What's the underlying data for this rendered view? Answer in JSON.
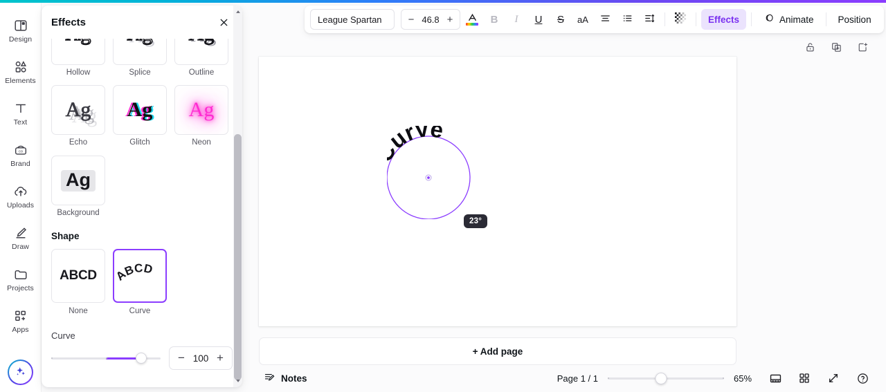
{
  "sidebar": {
    "items": [
      {
        "label": "Design",
        "icon": "design-icon"
      },
      {
        "label": "Elements",
        "icon": "elements-icon"
      },
      {
        "label": "Text",
        "icon": "text-icon"
      },
      {
        "label": "Brand",
        "icon": "brand-icon"
      },
      {
        "label": "Uploads",
        "icon": "uploads-icon"
      },
      {
        "label": "Draw",
        "icon": "draw-icon"
      },
      {
        "label": "Projects",
        "icon": "projects-icon"
      },
      {
        "label": "Apps",
        "icon": "apps-icon"
      }
    ],
    "magic_button_icon": "magic-sparkle-icon"
  },
  "panel": {
    "title": "Effects",
    "close_icon": "close-icon",
    "style_effects": [
      {
        "label": "Hollow",
        "sample": "Ag",
        "clipped": true
      },
      {
        "label": "Splice",
        "sample": "Ag",
        "clipped": true
      },
      {
        "label": "Outline",
        "sample": "Ag",
        "clipped": true
      },
      {
        "label": "Echo",
        "sample": "Ag",
        "clipped": false
      },
      {
        "label": "Glitch",
        "sample": "Ag",
        "clipped": false
      },
      {
        "label": "Neon",
        "sample": "Ag",
        "clipped": false
      },
      {
        "label": "Background",
        "sample": "Ag",
        "clipped": false
      }
    ],
    "shape": {
      "section_title": "Shape",
      "options": [
        {
          "label": "None",
          "sample": "ABCD",
          "selected": false
        },
        {
          "label": "Curve",
          "sample": "ABCD",
          "selected": true
        }
      ],
      "slider_label": "Curve",
      "slider_value": "100",
      "minus_label": "−",
      "plus_label": "+"
    }
  },
  "toolbar": {
    "font_name": "League Spartan",
    "font_size": "46.8",
    "size_minus": "−",
    "size_plus": "+",
    "text_color_icon": "text-color-icon",
    "bold_label": "B",
    "italic_label": "I",
    "underline_label": "U",
    "strikethrough_label": "S",
    "case_label": "aA",
    "align_icon": "align-center-icon",
    "list_icon": "bullet-list-icon",
    "spacing_icon": "line-spacing-icon",
    "transparency_icon": "transparency-icon",
    "effects_label": "Effects",
    "animate_label": "Animate",
    "animate_icon": "animate-icon",
    "position_label": "Position"
  },
  "canvas": {
    "lock_icon": "unlock-icon",
    "duplicate_icon": "duplicate-page-icon",
    "add_page_icon": "add-page-icon",
    "text_content": "Curve",
    "angle_badge": "23°",
    "guide_color": "#8b3dff",
    "add_page_label": "+ Add page"
  },
  "bottom": {
    "notes_label": "Notes",
    "notes_icon": "notes-icon",
    "page_count": "Page 1 / 1",
    "zoom_level": "65%",
    "presenter_icon": "presenter-view-icon",
    "grid_icon": "grid-view-icon",
    "fullscreen_icon": "fullscreen-icon",
    "help_icon": "help-icon"
  },
  "colors": {
    "accent": "#8b3dff",
    "accent_soft": "#ebe3fd",
    "badge_bg": "#2b2b35",
    "neon_pink": "#ff2bd1",
    "glitch_cyan": "#1ad7ef"
  }
}
